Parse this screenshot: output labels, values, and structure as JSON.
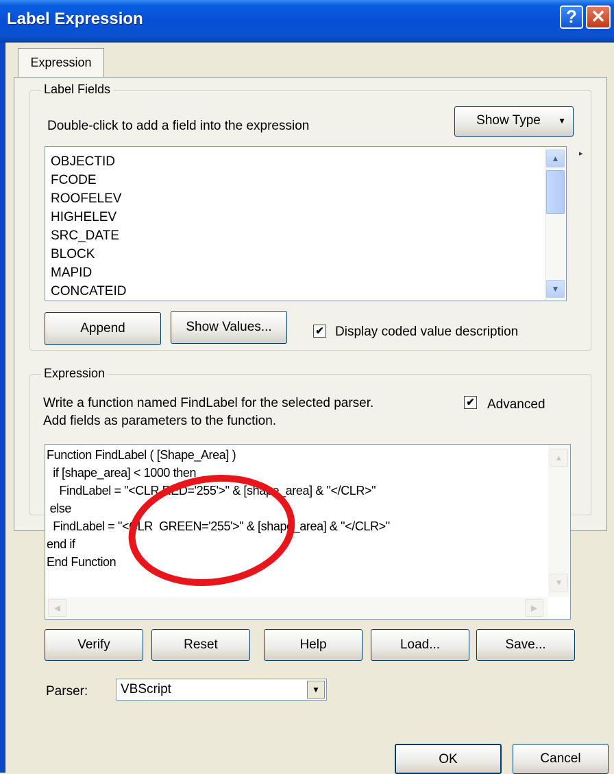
{
  "window": {
    "title": "Label Expression",
    "help_glyph": "?",
    "close_glyph": "✕"
  },
  "tab": {
    "label": "Expression"
  },
  "label_fields": {
    "group_label": "Label Fields",
    "instruction": "Double-click to add a field into the expression",
    "show_type_label": "Show Type",
    "fields": [
      "OBJECTID",
      "FCODE",
      "ROOFELEV",
      "HIGHELEV",
      "SRC_DATE",
      "BLOCK",
      "MAPID",
      "CONCATEID"
    ],
    "append_label": "Append",
    "show_values_label": "Show Values...",
    "display_coded_label": "Display coded value description",
    "display_coded_checked": true
  },
  "expression": {
    "group_label": "Expression",
    "hint_line1": "Write a function named FindLabel for the selected parser.",
    "hint_line2": "Add fields as parameters to the function.",
    "advanced_label": "Advanced",
    "advanced_checked": true,
    "code_lines": [
      "Function FindLabel ( [Shape_Area] )",
      "  if [shape_area] < 1000 then",
      "    FindLabel = \"<CLR RED='255'>\" & [shape_area] & \"</CLR>\"",
      " else",
      "  FindLabel = \"<CLR  GREEN='255'>\" & [shape_area] & \"</CLR>\"",
      "end if",
      "End Function"
    ],
    "verify_label": "Verify",
    "reset_label": "Reset",
    "help_label": "Help",
    "load_label": "Load...",
    "save_label": "Save...",
    "parser_label": "Parser:",
    "parser_value": "VBScript"
  },
  "footer": {
    "ok_label": "OK",
    "cancel_label": "Cancel"
  },
  "colors": {
    "title_bar": "#0650d6",
    "dialog_bg": "#ece9d8",
    "highlight_circle": "#e8161b"
  }
}
